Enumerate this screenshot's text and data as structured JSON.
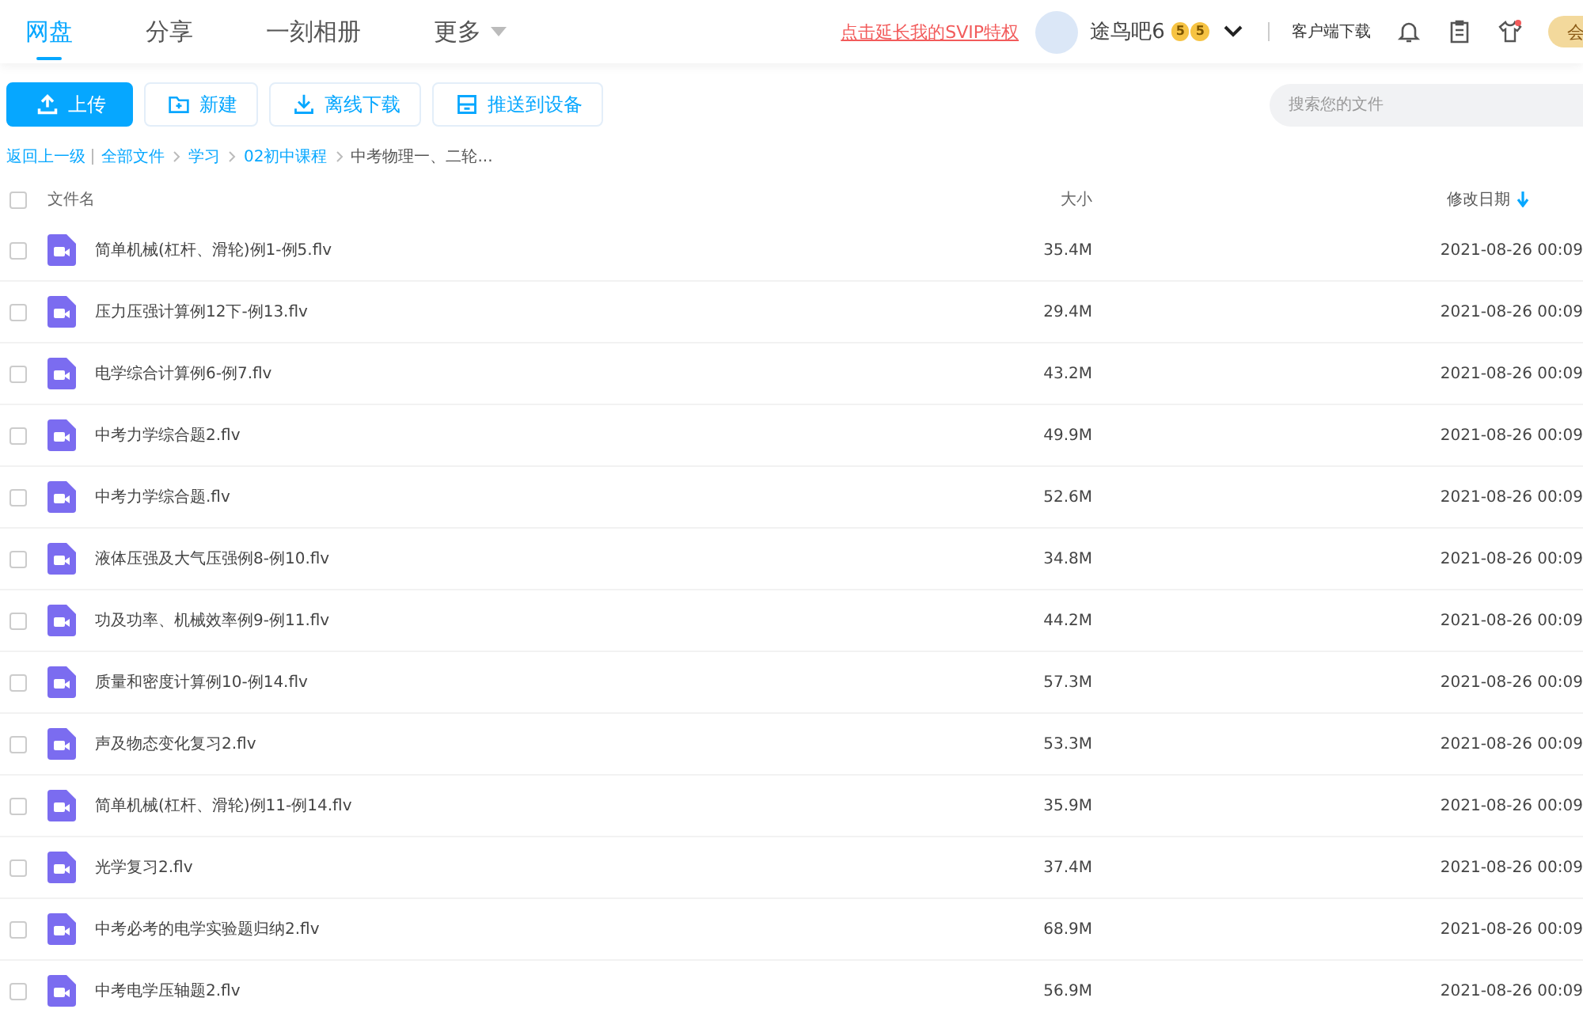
{
  "nav": {
    "tabs": [
      {
        "label": "网盘",
        "selected": true
      },
      {
        "label": "分享",
        "selected": false
      },
      {
        "label": "一刻相册",
        "selected": false
      },
      {
        "label": "更多",
        "selected": false,
        "kind": "dropdown"
      }
    ]
  },
  "account": {
    "promo_link": "点击延长我的SVIP特权",
    "username": "途鸟吧6",
    "badges": [
      "5",
      "5"
    ],
    "client_download": "客户端下载",
    "vip_button": "会"
  },
  "toolbar": {
    "buttons": [
      {
        "label": "上传",
        "kind": "upload"
      },
      {
        "label": "新建",
        "kind": "new-folder"
      },
      {
        "label": "离线下载",
        "kind": "download"
      },
      {
        "label": "推送到设备",
        "kind": "device"
      }
    ],
    "search": {
      "placeholder": "搜索您的文件"
    }
  },
  "breadcrumb": {
    "back": "返回上一级",
    "path": [
      {
        "label": "全部文件",
        "current": false
      },
      {
        "label": "学习",
        "current": false
      },
      {
        "label": "02初中课程",
        "current": false
      },
      {
        "label": "中考物理一、二轮...",
        "current": true
      }
    ]
  },
  "table": {
    "columns": [
      {
        "label": "文件名",
        "sorted": false
      },
      {
        "label": "大小",
        "sorted": false
      },
      {
        "label": "修改日期",
        "sorted": true
      }
    ],
    "all_checked": false,
    "rows": [
      {
        "name": "简单机械(杠杆、滑轮)例1-例5.flv",
        "size": "35.4M",
        "date": "2021-08-26 00:09",
        "checked": false
      },
      {
        "name": "压力压强计算例12下-例13.flv",
        "size": "29.4M",
        "date": "2021-08-26 00:09",
        "checked": false
      },
      {
        "name": "电学综合计算例6-例7.flv",
        "size": "43.2M",
        "date": "2021-08-26 00:09",
        "checked": false
      },
      {
        "name": "中考力学综合题2.flv",
        "size": "49.9M",
        "date": "2021-08-26 00:09",
        "checked": false
      },
      {
        "name": "中考力学综合题.flv",
        "size": "52.6M",
        "date": "2021-08-26 00:09",
        "checked": false
      },
      {
        "name": "液体压强及大气压强例8-例10.flv",
        "size": "34.8M",
        "date": "2021-08-26 00:09",
        "checked": false
      },
      {
        "name": "功及功率、机械效率例9-例11.flv",
        "size": "44.2M",
        "date": "2021-08-26 00:09",
        "checked": false
      },
      {
        "name": "质量和密度计算例10-例14.flv",
        "size": "57.3M",
        "date": "2021-08-26 00:09",
        "checked": false
      },
      {
        "name": "声及物态变化复习2.flv",
        "size": "53.3M",
        "date": "2021-08-26 00:09",
        "checked": false
      },
      {
        "name": "简单机械(杠杆、滑轮)例11-例14.flv",
        "size": "35.9M",
        "date": "2021-08-26 00:09",
        "checked": false
      },
      {
        "name": "光学复习2.flv",
        "size": "37.4M",
        "date": "2021-08-26 00:09",
        "checked": false
      },
      {
        "name": "中考必考的电学实验题归纳2.flv",
        "size": "68.9M",
        "date": "2021-08-26 00:09",
        "checked": false
      },
      {
        "name": "中考电学压轴题2.flv",
        "size": "56.9M",
        "date": "2021-08-26 00:09",
        "checked": false
      }
    ]
  }
}
